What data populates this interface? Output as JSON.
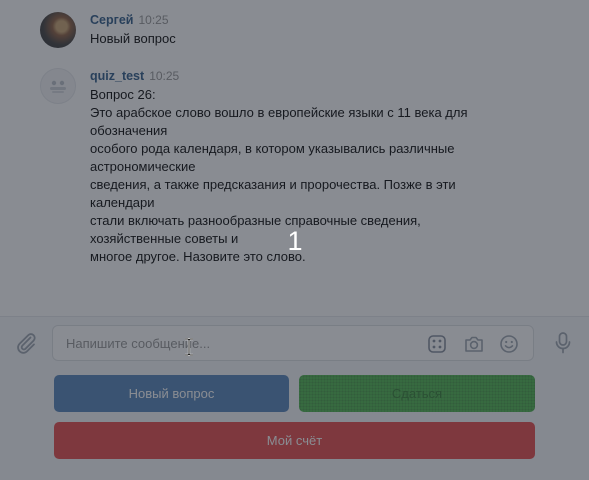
{
  "messages": [
    {
      "author": "Сергей",
      "time": "10:25",
      "lines": [
        "Новый вопрос"
      ],
      "avatar": "user-photo"
    },
    {
      "author": "quiz_test",
      "time": "10:25",
      "lines": [
        "Вопрос 26:",
        "Это арабское слово вошло в европейские языки с 11 века для",
        "обозначения",
        "особого рода календаря, в котором указывались различные",
        "астрономические",
        "сведения, а также предсказания и пророчества. Позже в эти",
        "календари",
        "стали включать разнообразные справочные сведения,",
        "хозяйственные советы и",
        "многое другое. Назовите это слово."
      ],
      "avatar": "bot-avatar"
    }
  ],
  "composer": {
    "placeholder": "Напишите сообщение...",
    "value": "",
    "icons": [
      "paperclip-icon",
      "keyboard-icon",
      "camera-icon",
      "smile-icon",
      "microphone-icon"
    ]
  },
  "keyboard": {
    "new_question": "Новый вопрос",
    "answer": "Сдаться",
    "my_score": "Мой счёт"
  },
  "overlay": {
    "number": "1"
  },
  "colors": {
    "author": "#2a5885",
    "new_question_button": "#5181b8",
    "answer_button": "#4bb34b",
    "my_score_button": "#e64646",
    "overlay": "rgba(40, 46, 56, 0.55)"
  }
}
